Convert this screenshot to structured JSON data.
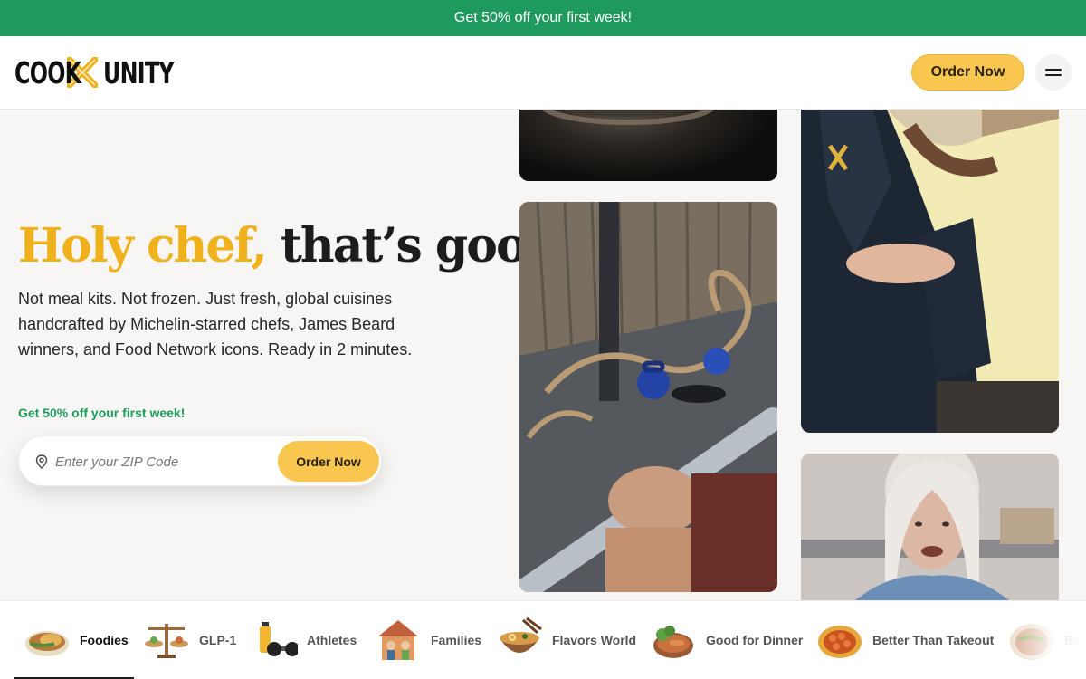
{
  "promo_banner": {
    "text": "Get 50% off your first week!"
  },
  "header": {
    "logo": {
      "word1": "COOK",
      "word2": "UNITY"
    },
    "order_button": "Order Now",
    "menu_icon": "hamburger-menu-icon"
  },
  "hero": {
    "title_accent": "Holy chef,",
    "title_rest": "that’s good",
    "subtitle": "Not meal kits. Not frozen. Just fresh, global cuisines handcrafted by Michelin-starred chefs, James Beard winners, and Food Network icons. Ready in 2 minutes.",
    "promo_text": "Get 50% off your first week!",
    "zip": {
      "placeholder": "Enter your ZIP Code",
      "value": "",
      "icon": "location-pin-icon"
    },
    "order_button": "Order Now"
  },
  "photos": [
    {
      "subject": "dark cookware"
    },
    {
      "subject": "gym floor with kettlebells, rope and barbell"
    },
    {
      "subject": "woman holding CookUnity meal bag"
    },
    {
      "subject": "smiling gray-haired woman in kitchen"
    }
  ],
  "categories": {
    "selected": "Foodies",
    "items": [
      {
        "label": "Foodies",
        "icon": "grilled-food-plate-icon"
      },
      {
        "label": "GLP-1",
        "icon": "balance-scale-icon"
      },
      {
        "label": "Athletes",
        "icon": "dumbbell-bottle-icon"
      },
      {
        "label": "Families",
        "icon": "family-house-icon"
      },
      {
        "label": "Flavors World",
        "icon": "ramen-bowl-icon"
      },
      {
        "label": "Good for Dinner",
        "icon": "dinner-plate-icon"
      },
      {
        "label": "Better Than Takeout",
        "icon": "takeout-plate-icon"
      },
      {
        "label": "Be",
        "icon": "salad-bowl-icon"
      }
    ]
  },
  "colors": {
    "green": "#1f9a5e",
    "yellow": "#f9c74f",
    "accent_title": "#f0b21c",
    "text": "#1f1f1f"
  }
}
